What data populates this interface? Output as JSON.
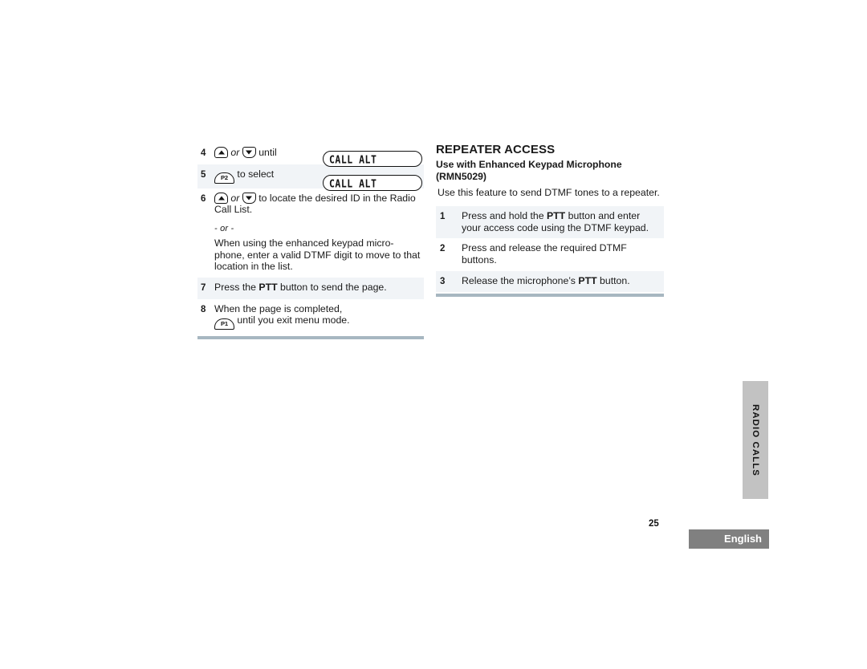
{
  "document": {
    "page_number": "25",
    "language_label": "English",
    "side_tab_label": "RADIO CALLS"
  },
  "colors": {
    "band": "#f1f4f7",
    "rule": "#a7b7c1",
    "side_tab": "#c2c2c2",
    "lang_box": "#808080"
  },
  "left_column": {
    "steps": [
      {
        "number": "4",
        "icons": [
          "up-arrow-key",
          "down-arrow-key"
        ],
        "text_before": "",
        "or_word": "or",
        "text_after": "until",
        "shaded": false
      },
      {
        "number": "5",
        "icons": [
          "p2-key"
        ],
        "text_after": "to select",
        "shaded": true
      },
      {
        "number": "6",
        "icons": [
          "up-arrow-key",
          "down-arrow-key"
        ],
        "or_word": "or",
        "text_after": "to locate the desired ID in the Radio Call List.",
        "shaded": false
      }
    ],
    "or_separator": "- or -",
    "note": "When using the enhanced keypad micro-phone, enter a valid DTMF digit to move to that location in the list.",
    "step7": {
      "number": "7",
      "text_before": "Press the ",
      "bold": "PTT",
      "text_after": " button to send the page.",
      "shaded": true
    },
    "step8": {
      "number": "8",
      "line1": "When the page is completed,",
      "icon": "p1-key",
      "line2_after": "until you exit menu mode.",
      "shaded": false
    }
  },
  "lcd_displays": [
    {
      "id": "lcd-1",
      "text": "CALL  ALT"
    },
    {
      "id": "lcd-2",
      "text": "CALL  ALT"
    }
  ],
  "keys": {
    "p1_label": "P1",
    "p2_label": "P2"
  },
  "right_column": {
    "heading": "REPEATER ACCESS",
    "subheading_line1": "Use with Enhanced Keypad Microphone",
    "subheading_line2": "(RMN5029)",
    "intro": "Use this feature to send DTMF tones to a repeater.",
    "steps": [
      {
        "number": "1",
        "text_before": "Press and hold the ",
        "bold": "PTT",
        "text_after": " button and enter your access code using the DTMF  keypad.",
        "shaded": true
      },
      {
        "number": "2",
        "text_before": "Press and release the required DTMF buttons.",
        "bold": "",
        "text_after": "",
        "shaded": false
      },
      {
        "number": "3",
        "text_before": "Release the microphone’s ",
        "bold": "PTT",
        "text_after": " button.",
        "shaded": true
      }
    ]
  }
}
